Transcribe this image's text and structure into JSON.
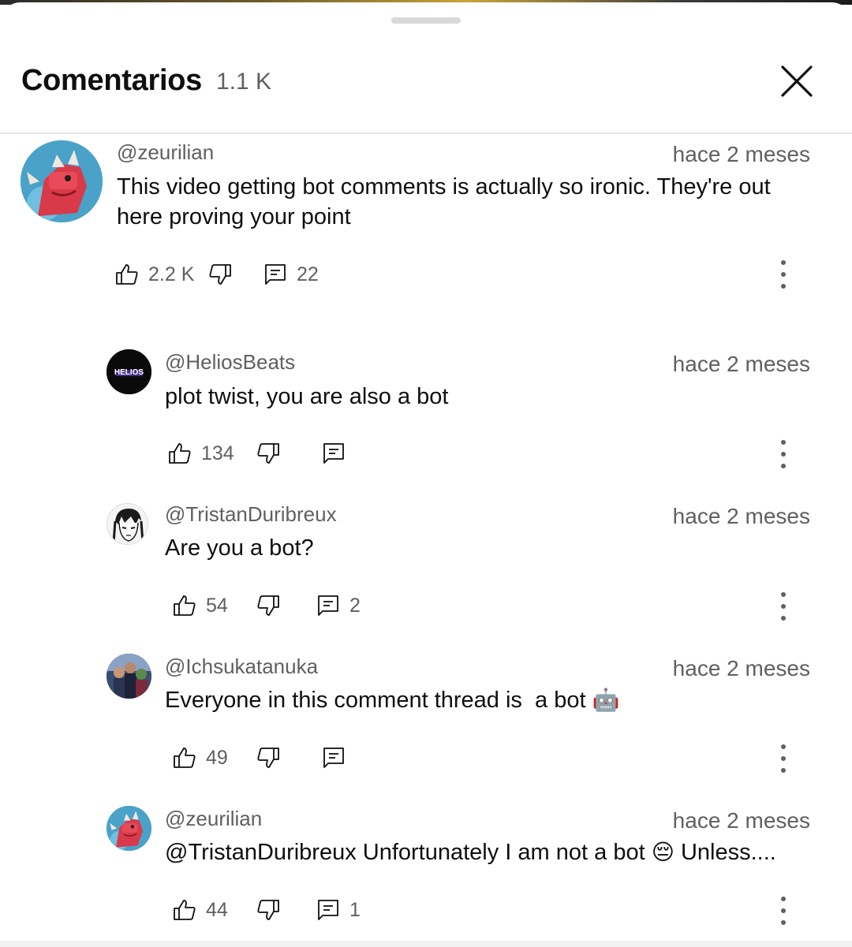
{
  "header": {
    "title": "Comentarios",
    "count": "1.1 K"
  },
  "comments": [
    {
      "handle": "@zeurilian",
      "time": "hace 2 meses",
      "text": "This video getting bot comments is actually so ironic. They're out here proving your point",
      "likes": "2.2 K",
      "replies": "22",
      "avatar_icon": "red-dinosaur-avatar"
    },
    {
      "handle": "@HeliosBeats",
      "time": "hace 2 meses",
      "text": "plot twist, you are also a bot",
      "likes": "134",
      "replies": "",
      "avatar_icon": "helios-logo-avatar",
      "avatar_text": "HELIOS"
    },
    {
      "handle": "@TristanDuribreux",
      "time": "hace 2 meses",
      "text": "Are you a bot?",
      "likes": "54",
      "replies": "2",
      "avatar_icon": "sketch-face-avatar"
    },
    {
      "handle": "@Ichsukatanuka",
      "time": "hace 2 meses",
      "text": "Everyone in this comment thread is  a bot",
      "emoji": "🤖",
      "likes": "49",
      "replies": "",
      "avatar_icon": "group-photo-avatar"
    },
    {
      "handle": "@zeurilian",
      "time": "hace 2 meses",
      "text": "@TristanDuribreux Unfortunately I am not a bot",
      "emoji": "😔",
      "text_after": "Unless....",
      "likes": "44",
      "replies": "1",
      "avatar_icon": "red-dinosaur-avatar"
    }
  ],
  "colors": {
    "text": "#0f0f0f",
    "secondary": "#606060",
    "divider": "#e5e5e5"
  }
}
